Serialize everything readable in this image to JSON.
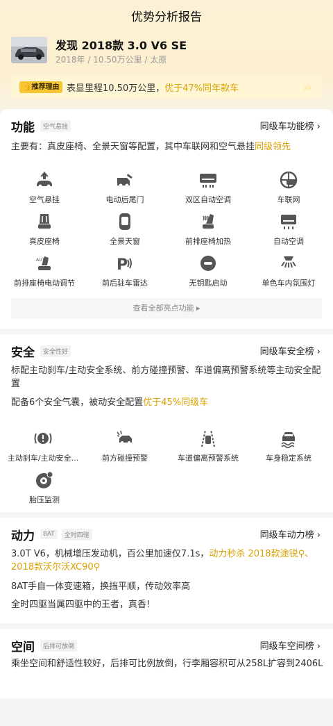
{
  "page_title": "优势分析报告",
  "car": {
    "name": "发现 2018款 3.0 V6 SE",
    "meta": "2018年 / 10.50万公里 / 太原"
  },
  "reason": {
    "tag": "推荐理由",
    "text_prefix": "表显里程10.50万公里，",
    "text_highlight": "优于47%同年款车"
  },
  "features": {
    "title": "功能",
    "tag": "空气悬挂",
    "rank_link": "同级车功能榜 ›",
    "desc_prefix": "主要有：真皮座椅、全景天窗等配置，其中车联网和空气悬挂",
    "desc_highlight": "同级领先",
    "items": [
      {
        "label": "空气悬挂",
        "icon": "air-suspension-icon"
      },
      {
        "label": "电动后尾门",
        "icon": "power-tailgate-icon"
      },
      {
        "label": "双区自动空调",
        "icon": "dual-zone-ac-icon"
      },
      {
        "label": "车联网",
        "icon": "connected-car-icon"
      },
      {
        "label": "真皮座椅",
        "icon": "leather-seat-icon"
      },
      {
        "label": "全景天窗",
        "icon": "panoramic-sunroof-icon"
      },
      {
        "label": "前排座椅加热",
        "icon": "seat-heating-icon"
      },
      {
        "label": "自动空调",
        "icon": "auto-ac-icon"
      },
      {
        "label": "前排座椅电动调节",
        "icon": "power-seat-icon"
      },
      {
        "label": "前后驻车雷达",
        "icon": "parking-radar-icon"
      },
      {
        "label": "无钥匙启动",
        "icon": "keyless-start-icon"
      },
      {
        "label": "单色车内氛围灯",
        "icon": "ambient-light-icon"
      }
    ],
    "more_label": "查看全部亮点功能 ▸"
  },
  "safety": {
    "title": "安全",
    "tag": "安全性好",
    "rank_link": "同级车安全榜 ›",
    "desc1": "标配主动刹车/主动安全系统、前方碰撞预警、车道偏离预警系统等主动安全配置",
    "desc2_prefix": "配备6个安全气囊，被动安全配置",
    "desc2_highlight": "优于45%同级车",
    "items": [
      {
        "label": "主动刹车/主动安全...",
        "icon": "active-brake-icon"
      },
      {
        "label": "前方碰撞预警",
        "icon": "collision-warning-icon"
      },
      {
        "label": "车道偏离预警系统",
        "icon": "lane-departure-icon"
      },
      {
        "label": "车身稳定系统",
        "icon": "stability-control-icon"
      },
      {
        "label": "胎压监测",
        "icon": "tire-pressure-icon"
      }
    ]
  },
  "power": {
    "title": "动力",
    "tags": [
      "8AT",
      "全时四驱"
    ],
    "rank_link": "同级车动力榜 ›",
    "line1_prefix": "3.0T V6，机械增压发动机，百公里加速仅7.1s，",
    "line1_highlight": "动力秒杀 2018款途锐",
    "line1_rest": "、2018款沃尔沃XC90",
    "line2": "8AT手自一体变速箱，换挡平顺，传动效率高",
    "line3": "全时四驱当属四驱中的王者，真香!"
  },
  "space": {
    "title": "空间",
    "tag": "后排可放倒",
    "rank_link": "同级车空间榜 ›",
    "desc": "乘坐空间和舒适性较好，后排可比例放倒，行李厢容积可从258L扩容到2406L"
  }
}
